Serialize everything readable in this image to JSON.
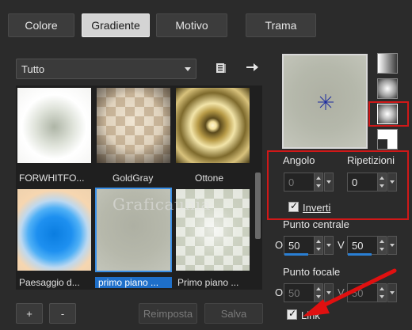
{
  "tabs": [
    {
      "label": "Colore"
    },
    {
      "label": "Gradiente",
      "active": true
    },
    {
      "label": "Motivo"
    },
    {
      "label": "Trama"
    }
  ],
  "filter": {
    "selected": "Tutto"
  },
  "gradients": [
    {
      "label": "FORWHITFO..."
    },
    {
      "label": "GoldGray"
    },
    {
      "label": "Ottone"
    },
    {
      "label": "Paesaggio d..."
    },
    {
      "label": "primo piano ...",
      "selected": true
    },
    {
      "label": "Primo piano ..."
    }
  ],
  "buttons": {
    "add": "+",
    "remove": "-",
    "reset": "Reimposta",
    "save": "Salva"
  },
  "settings": {
    "angle_label": "Angolo",
    "angle_value": "0",
    "repeat_label": "Ripetizioni",
    "repeat_value": "0",
    "invert_label": "Inverti",
    "invert_checked": true,
    "center_label": "Punto centrale",
    "center_o_label": "O",
    "center_o_value": "50",
    "center_v_label": "V",
    "center_v_value": "50",
    "focal_label": "Punto focale",
    "focal_o_label": "O",
    "focal_o_value": "50",
    "focal_v_label": "V",
    "focal_v_value": "50",
    "link_label": "Link",
    "link_checked": true
  },
  "watermark": "Graficaunia",
  "colors": {
    "accent": "#1e6fc9",
    "highlight": "#d01818"
  }
}
